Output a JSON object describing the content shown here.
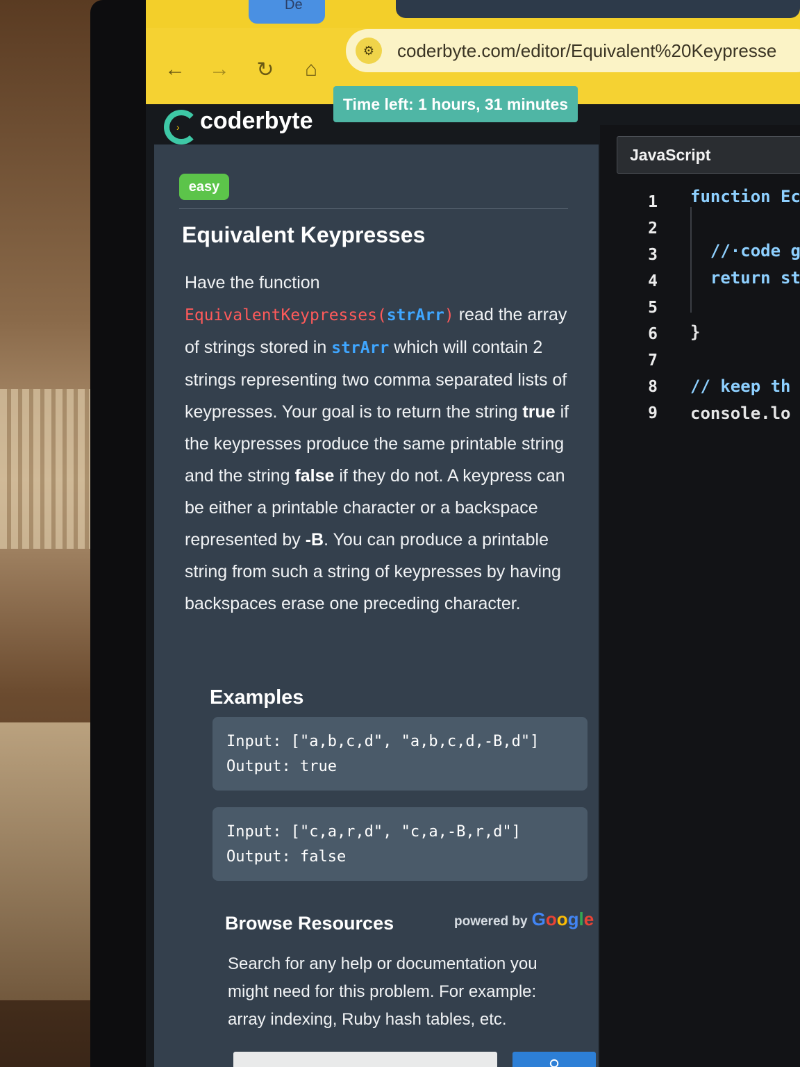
{
  "browser": {
    "tab_partial_label": "De",
    "url": "coderbyte.com/editor/Equivalent%20Keypresse"
  },
  "app": {
    "logo": "coderbyte",
    "timer": "Time left: 1 hours, 31 minutes"
  },
  "problem": {
    "difficulty": "easy",
    "title": "Equivalent Keypresses",
    "desc_intro": "Have the function",
    "fn_name": "EquivalentKeypresses",
    "fn_paren_open": "(",
    "fn_arg": "strArr",
    "fn_paren_close": ")",
    "desc_part2": " read the array of strings stored in ",
    "desc_arg2": "strArr",
    "desc_part3": " which will contain 2 strings representing two comma separated lists of keypresses. Your goal is to return the string ",
    "bold_true": "true",
    "desc_part4": " if the keypresses produce the same printable string and the string ",
    "bold_false": "false",
    "desc_part5": " if they do not. A keypress can be either a printable character or a backspace represented by ",
    "bold_backspace": "-B",
    "desc_part6": ". You can produce a printable string from such a string of keypresses by having backspaces erase one preceding character.",
    "examples_title": "Examples",
    "examples": [
      {
        "input": "Input: [\"a,b,c,d\", \"a,b,c,d,-B,d\"]",
        "output": "Output: true"
      },
      {
        "input": "Input: [\"c,a,r,d\", \"c,a,-B,r,d\"]",
        "output": "Output: false"
      }
    ],
    "resources_title": "Browse Resources",
    "powered_by": "powered by",
    "google_word": "Google",
    "resources_text": "Search for any help or documentation you might need for this problem. For example: array indexing, Ruby hash tables, etc."
  },
  "editor": {
    "language": "JavaScript",
    "line_numbers": [
      "1",
      "2",
      "3",
      "4",
      "5",
      "6",
      "7",
      "8",
      "9"
    ],
    "code_lines": [
      {
        "parts": [
          {
            "t": "function Ec",
            "c": "kw"
          }
        ]
      },
      {
        "parts": [
          {
            "t": "",
            "c": ""
          }
        ]
      },
      {
        "parts": [
          {
            "t": "  //·code g",
            "c": "cm"
          }
        ]
      },
      {
        "parts": [
          {
            "t": "  return st",
            "c": "kw"
          }
        ]
      },
      {
        "parts": [
          {
            "t": "",
            "c": ""
          }
        ]
      },
      {
        "parts": [
          {
            "t": "}",
            "c": ""
          }
        ]
      },
      {
        "parts": [
          {
            "t": "",
            "c": ""
          }
        ]
      },
      {
        "parts": [
          {
            "t": "// keep th",
            "c": "cm"
          }
        ]
      },
      {
        "parts": [
          {
            "t": "console.lo",
            "c": ""
          }
        ]
      }
    ]
  },
  "colors": {
    "chrome_yellow": "#f5d232",
    "panel": "#34404d",
    "accent_teal": "#4fb6a5",
    "easy_green": "#5cc44a",
    "fn_red": "#ff5a5a",
    "arg_blue": "#3fa6ff"
  }
}
